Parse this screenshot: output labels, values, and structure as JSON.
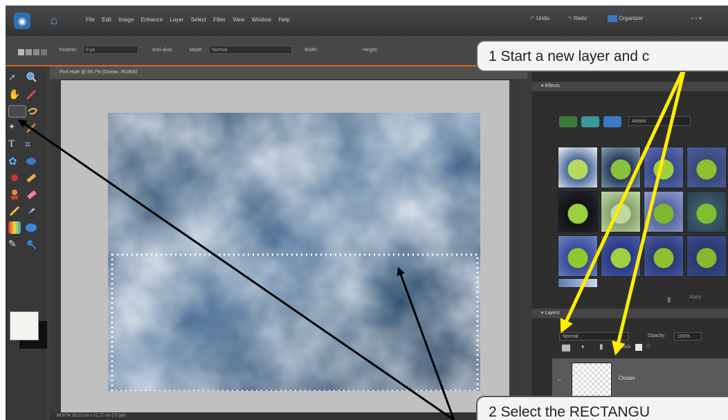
{
  "app": {
    "menu": [
      "File",
      "Edit",
      "Image",
      "Enhance",
      "Layer",
      "Select",
      "Filter",
      "View",
      "Window",
      "Help"
    ],
    "undo": "Undo",
    "redo": "Redo",
    "organizer": "Organizer",
    "window_controls": "– ▫ ×"
  },
  "options_bar": {
    "feather_label": "Feather:",
    "feather_value": "0 px",
    "antialias": "Anti-alias",
    "mode_label": "Mode:",
    "mode_value": "Normal",
    "width_label": "Width:",
    "height_label": "Height:"
  },
  "document": {
    "title": "Port Hole @ 66.7% (Ocean, RGB/8)",
    "status": "66.67%     28.22 cm x 21.17 cm (72 ppi)"
  },
  "panels": {
    "effects_title": "Effects",
    "effects_filter": "Artistic",
    "apply_label": "Apply",
    "layers_title": "Layers",
    "blend_mode": "Normal",
    "opacity_label": "Opacity:",
    "opacity_value": "100%",
    "lock_label": "Lock:",
    "layer_name": "Ocean"
  },
  "callouts": {
    "c1": "1 Start a new layer and c",
    "c2": "2 Select the RECTANGU"
  },
  "icons": [
    "app-logo-icon",
    "home-icon",
    "undo-icon",
    "redo-icon",
    "organizer-icon",
    "move-tool-icon",
    "zoom-tool-icon",
    "hand-tool-icon",
    "eyedropper-tool-icon",
    "rectangular-marquee-tool-icon",
    "lasso-tool-icon",
    "magic-wand-tool-icon",
    "brush-tool-icon",
    "type-tool-icon",
    "crop-tool-icon",
    "shape-tool-icon",
    "bucket-tool-icon",
    "red-eye-tool-icon",
    "healing-tool-icon",
    "stamp-tool-icon",
    "eraser-tool-icon",
    "pencil-tool-icon",
    "smudge-tool-icon",
    "gradient-tool-icon",
    "ellipse-shape-icon",
    "sponge-tool-icon",
    "dodge-tool-icon",
    "new-layer-icon",
    "trash-icon",
    "lock-icon",
    "eye-icon"
  ],
  "colors": {
    "accent_orange": "#d2691e",
    "arrow_yellow": "#ffee00",
    "panel_bg": "#2e2e2e"
  }
}
